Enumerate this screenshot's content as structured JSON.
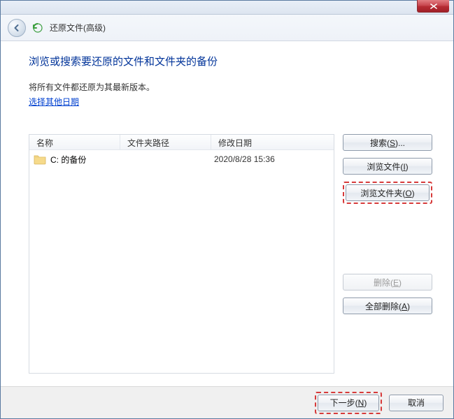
{
  "titlebar": {
    "close_tooltip": "关闭"
  },
  "nav": {
    "crumb_label": "还原文件(高级)"
  },
  "main": {
    "heading": "浏览或搜索要还原的文件和文件夹的备份",
    "subtext": "将所有文件都还原为其最新版本。",
    "choose_date_link": "选择其他日期"
  },
  "columns": {
    "name": "名称",
    "path": "文件夹路径",
    "date": "修改日期"
  },
  "rows": [
    {
      "name": "C: 的备份",
      "path": "",
      "date": "2020/8/28 15:36"
    }
  ],
  "buttons": {
    "search": "搜索(S)...",
    "browse_files": "浏览文件(I)",
    "browse_folders": "浏览文件夹(O)",
    "remove": "删除(E)",
    "remove_all": "全部删除(A)",
    "next": "下一步(N)",
    "cancel": "取消"
  }
}
